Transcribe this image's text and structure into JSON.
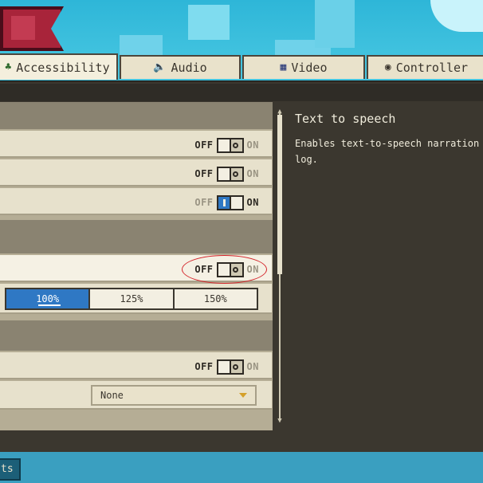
{
  "tabs": [
    {
      "label": "Accessibility",
      "icon": "accessibility-icon",
      "active": true
    },
    {
      "label": "Audio",
      "icon": "speaker-icon",
      "active": false
    },
    {
      "label": "Video",
      "icon": "monitor-icon",
      "active": false
    },
    {
      "label": "Controller",
      "icon": "gamepad-icon",
      "active": false
    }
  ],
  "toggles": {
    "off_label": "OFF",
    "on_label": "ON",
    "rows": [
      {
        "state": "off"
      },
      {
        "state": "off"
      },
      {
        "state": "on"
      },
      {
        "state": "off"
      },
      {
        "state": "off"
      }
    ]
  },
  "scale_options": [
    "100%",
    "125%",
    "150%"
  ],
  "scale_selected": "100%",
  "dropdown": {
    "value": "None"
  },
  "description": {
    "title": "Text to speech",
    "body": "Enables text-to-speech narration log."
  },
  "bottom_button": {
    "label": "ts"
  },
  "colors": {
    "accent_blue": "#2f78c4",
    "panel_dark": "#3b372f",
    "row_light": "#e7e1cc",
    "highlight_red": "#d4242a"
  }
}
